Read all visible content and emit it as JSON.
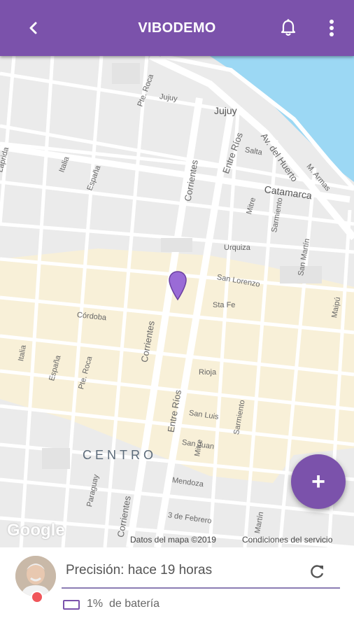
{
  "app_bar": {
    "title": "VIBODEMO",
    "back_icon": "chevron-left-icon",
    "notification_icon": "bell-icon",
    "menu_icon": "more-vert-icon",
    "color": "#7b52ab"
  },
  "map": {
    "district_label": "CENTRO",
    "streets": {
      "jujuy_small": "Jujuy",
      "jujuy": "Jujuy",
      "pte_roca_top": "Pte. Roca",
      "salta": "Salta",
      "av_del_huerto": "Av. del Huerto",
      "m_armas": "M. Armas",
      "entre_rios_top": "Entre Ríos",
      "corrientes_top": "Corrientes",
      "catamarca": "Catamarca",
      "italia_top": "Italia",
      "espana_top": "España",
      "laprida_top": "Laprida",
      "mitre_top": "Mitre",
      "sarmiento_top": "Sarmiento",
      "urquiza": "Urquiza",
      "san_martin_top": "San Martín",
      "san_lorenzo": "San Lorenzo",
      "maipu": "Maipú",
      "sta_fe": "Sta Fe",
      "cordoba": "Córdoba",
      "corrientes_mid": "Corrientes",
      "italia_mid": "Italia",
      "espana_mid": "España",
      "pte_roca_mid": "Pte. Roca",
      "rioja": "Rioja",
      "entre_rios_mid": "Entre Ríos",
      "san_luis": "San Luis",
      "sarmiento_mid": "Sarmiento",
      "san_juan": "San Juan",
      "mitre_bottom": "Mitre",
      "mendoza": "Mendoza",
      "paraguay": "Paraguay",
      "corrientes_bottom": "Corrientes",
      "tres_de_febrero": "3 de Febrero",
      "san_martin_bottom": "Martín"
    },
    "google_logo": "Google",
    "attribution": "Datos del mapa ©2019",
    "terms": "Condiciones del servicio",
    "pin_color": "#9a6bd6",
    "water_color": "#9cd8f4",
    "commercial_zone_color": "#f8f0d8"
  },
  "fab": {
    "label": "+",
    "icon": "plus-icon"
  },
  "device_panel": {
    "precision_text": "Precisión: hace 19 horas",
    "refresh_icon": "refresh-icon",
    "battery_value": "1%",
    "battery_label": "de batería",
    "battery_icon": "battery-icon",
    "status_dot_color": "#f0565a"
  }
}
